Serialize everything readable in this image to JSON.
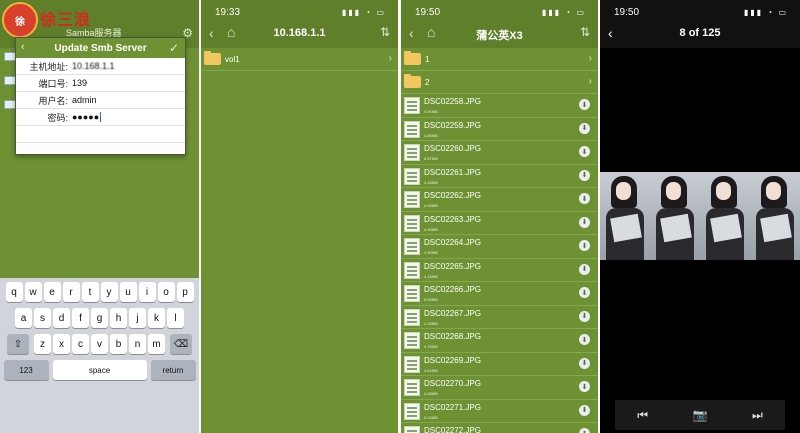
{
  "panel1": {
    "watermark": "徐三浪",
    "behind_title": "Samba服务器",
    "dialog": {
      "title": "Update Smb Server",
      "host_label": "主机地址:",
      "host_value": "10.168.1.1",
      "port_label": "端口号:",
      "port_value": "139",
      "user_label": "用户名:",
      "user_value": "admin",
      "pass_label": "密码:",
      "pass_value": "●●●●●"
    },
    "keyboard": {
      "row1": [
        "q",
        "w",
        "e",
        "r",
        "t",
        "y",
        "u",
        "i",
        "o",
        "p"
      ],
      "row2": [
        "a",
        "s",
        "d",
        "f",
        "g",
        "h",
        "j",
        "k",
        "l"
      ],
      "row3": [
        "z",
        "x",
        "c",
        "v",
        "b",
        "n",
        "m"
      ],
      "shift": "⇧",
      "backspace": "⌫",
      "num": "123",
      "space": "space",
      "return": "return"
    }
  },
  "panel2": {
    "time": "19:33",
    "title": "10.168.1.1",
    "folders": [
      {
        "name": "vol1"
      }
    ]
  },
  "panel3": {
    "time": "19:50",
    "title": "蒲公英X3",
    "folders": [
      {
        "name": "1"
      },
      {
        "name": "2"
      }
    ],
    "files": [
      {
        "name": "DSC02258.JPG",
        "size": "4.91MB"
      },
      {
        "name": "DSC02259.JPG",
        "size": "4.88MB"
      },
      {
        "name": "DSC02260.JPG",
        "size": "5.87MB"
      },
      {
        "name": "DSC02261.JPG",
        "size": "4.45MB"
      },
      {
        "name": "DSC02262.JPG",
        "size": "4.53MB"
      },
      {
        "name": "DSC02263.JPG",
        "size": "4.30MB"
      },
      {
        "name": "DSC02264.JPG",
        "size": "4.50MB"
      },
      {
        "name": "DSC02265.JPG",
        "size": "4.18MB"
      },
      {
        "name": "DSC02266.JPG",
        "size": "5.39MB"
      },
      {
        "name": "DSC02267.JPG",
        "size": "4.25MB"
      },
      {
        "name": "DSC02268.JPG",
        "size": "4.76MB"
      },
      {
        "name": "DSC02269.JPG",
        "size": "4.64MB"
      },
      {
        "name": "DSC02270.JPG",
        "size": "4.38MB"
      },
      {
        "name": "DSC02271.JPG",
        "size": "6.24MB"
      },
      {
        "name": "DSC02272.JPG",
        "size": ""
      }
    ]
  },
  "panel4": {
    "time": "19:50",
    "title": "8 of 125"
  }
}
